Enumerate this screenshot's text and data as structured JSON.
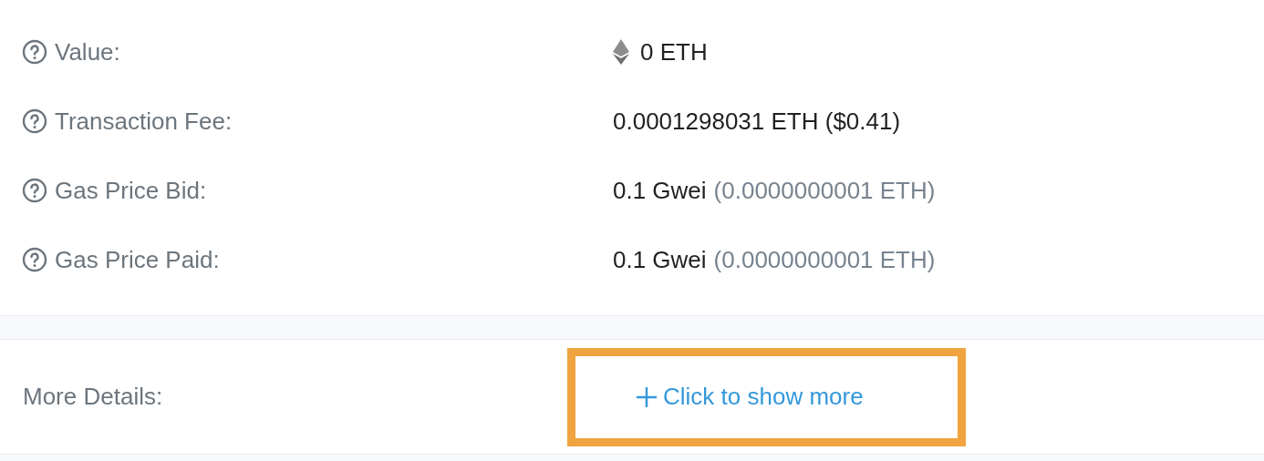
{
  "overview": {
    "rows": [
      {
        "kind": "ether",
        "label": "Value:",
        "value": "0 ETH"
      },
      {
        "kind": "plain",
        "label": "Transaction Fee:",
        "value": "0.0001298031 ETH ($0.41)"
      },
      {
        "kind": "plain",
        "label": "Gas Price Bid:",
        "value": "0.1 Gwei",
        "note": "(0.0000000001 ETH)"
      },
      {
        "kind": "plain",
        "label": "Gas Price Paid:",
        "value": "0.1 Gwei",
        "note": "(0.0000000001 ETH)"
      }
    ]
  },
  "more_details": {
    "label": "More Details:",
    "link": "Click to show more",
    "highlighted": true
  }
}
